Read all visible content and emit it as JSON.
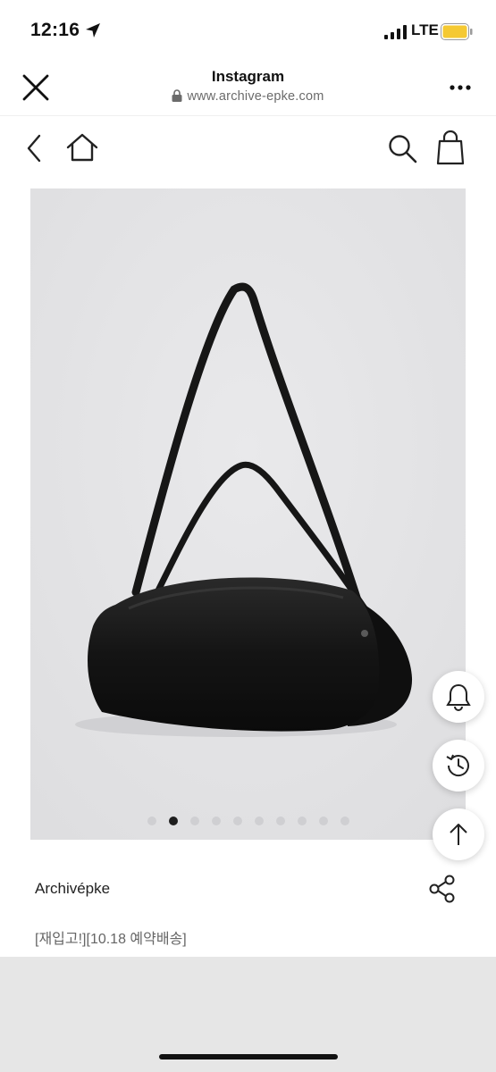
{
  "status_bar": {
    "time": "12:16",
    "network": "LTE",
    "battery_color": "#f5c932"
  },
  "browser": {
    "title": "Instagram",
    "url": "www.archive-epke.com"
  },
  "nav": {
    "icons": [
      "back-icon",
      "home-icon",
      "search-icon",
      "shopping-bag-icon"
    ]
  },
  "product": {
    "image_background": "#e4e4e6",
    "carousel": {
      "total": 10,
      "active": 2
    },
    "brand": "Archivépke",
    "tag": "[재입고!][10.18 예약배송]"
  },
  "floating_buttons": [
    "bell-icon",
    "history-icon",
    "arrow-up-icon"
  ]
}
